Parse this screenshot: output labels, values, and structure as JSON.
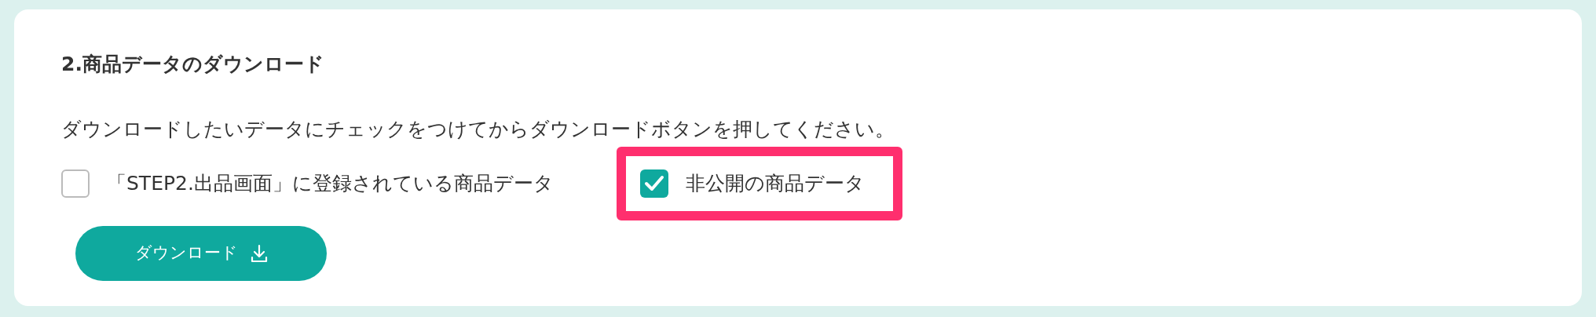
{
  "section": {
    "title": "2.商品データのダウンロード",
    "instruction": "ダウンロードしたいデータにチェックをつけてからダウンロードボタンを押してください。",
    "options": [
      {
        "label": "「STEP2.出品画面」に登録されている商品データ",
        "checked": false,
        "highlighted": false
      },
      {
        "label": "非公開の商品データ",
        "checked": true,
        "highlighted": true
      }
    ],
    "button": {
      "label": "ダウンロード"
    }
  }
}
